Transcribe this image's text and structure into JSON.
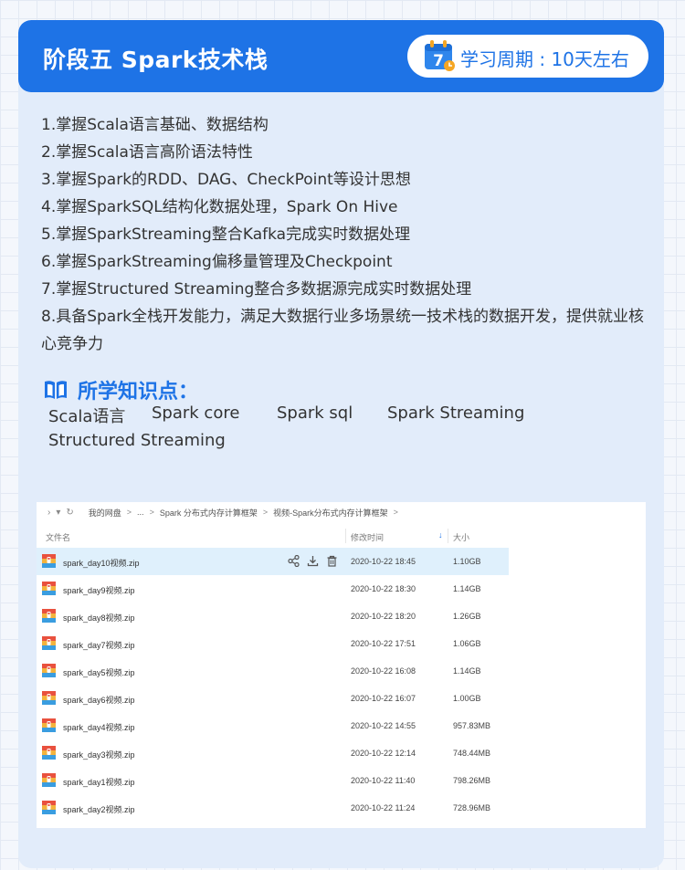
{
  "header": {
    "title": "阶段五 Spark技术栈",
    "calendar_icon_number": "7",
    "cycle": "学习周期 : 10天左右",
    "accent_color": "#1e73e6"
  },
  "goals": [
    "1.掌握Scala语言基础、数据结构",
    "2.掌握Scala语言高阶语法特性",
    "3.掌握Spark的RDD、DAG、CheckPoint等设计思想",
    "4.掌握SparkSQL结构化数据处理，Spark On Hive",
    "5.掌握SparkStreaming整合Kafka完成实时数据处理",
    "6.掌握SparkStreaming偏移量管理及Checkpoint",
    "7.掌握Structured Streaming整合多数据源完成实时数据处理",
    "8.具备Spark全栈开发能力，满足大数据行业多场景统一技术栈的数据开发，提供就业核心竞争力"
  ],
  "knowledge": {
    "title": "所学知识点：",
    "items": [
      "Scala语言",
      "Spark core",
      "Spark sql",
      "Spark Streaming",
      "Structured Streaming"
    ]
  },
  "file_manager": {
    "breadcrumbs": [
      "我的网盘",
      "...",
      "Spark 分布式内存计算框架",
      "视频-Spark分布式内存计算框架"
    ],
    "columns": {
      "name": "文件名",
      "modified": "修改时间",
      "size": "大小"
    },
    "files": [
      {
        "name": "spark_day10视频.zip",
        "date": "2020-10-22 18:45",
        "size": "1.10GB"
      },
      {
        "name": "spark_day9视频.zip",
        "date": "2020-10-22 18:30",
        "size": "1.14GB"
      },
      {
        "name": "spark_day8视频.zip",
        "date": "2020-10-22 18:20",
        "size": "1.26GB"
      },
      {
        "name": "spark_day7视频.zip",
        "date": "2020-10-22 17:51",
        "size": "1.06GB"
      },
      {
        "name": "spark_day5视频.zip",
        "date": "2020-10-22 16:08",
        "size": "1.14GB"
      },
      {
        "name": "spark_day6视频.zip",
        "date": "2020-10-22 16:07",
        "size": "1.00GB"
      },
      {
        "name": "spark_day4视频.zip",
        "date": "2020-10-22 14:55",
        "size": "957.83MB"
      },
      {
        "name": "spark_day3视频.zip",
        "date": "2020-10-22 12:14",
        "size": "748.44MB"
      },
      {
        "name": "spark_day1视频.zip",
        "date": "2020-10-22 11:40",
        "size": "798.26MB"
      },
      {
        "name": "spark_day2视频.zip",
        "date": "2020-10-22 11:24",
        "size": "728.96MB"
      }
    ]
  }
}
